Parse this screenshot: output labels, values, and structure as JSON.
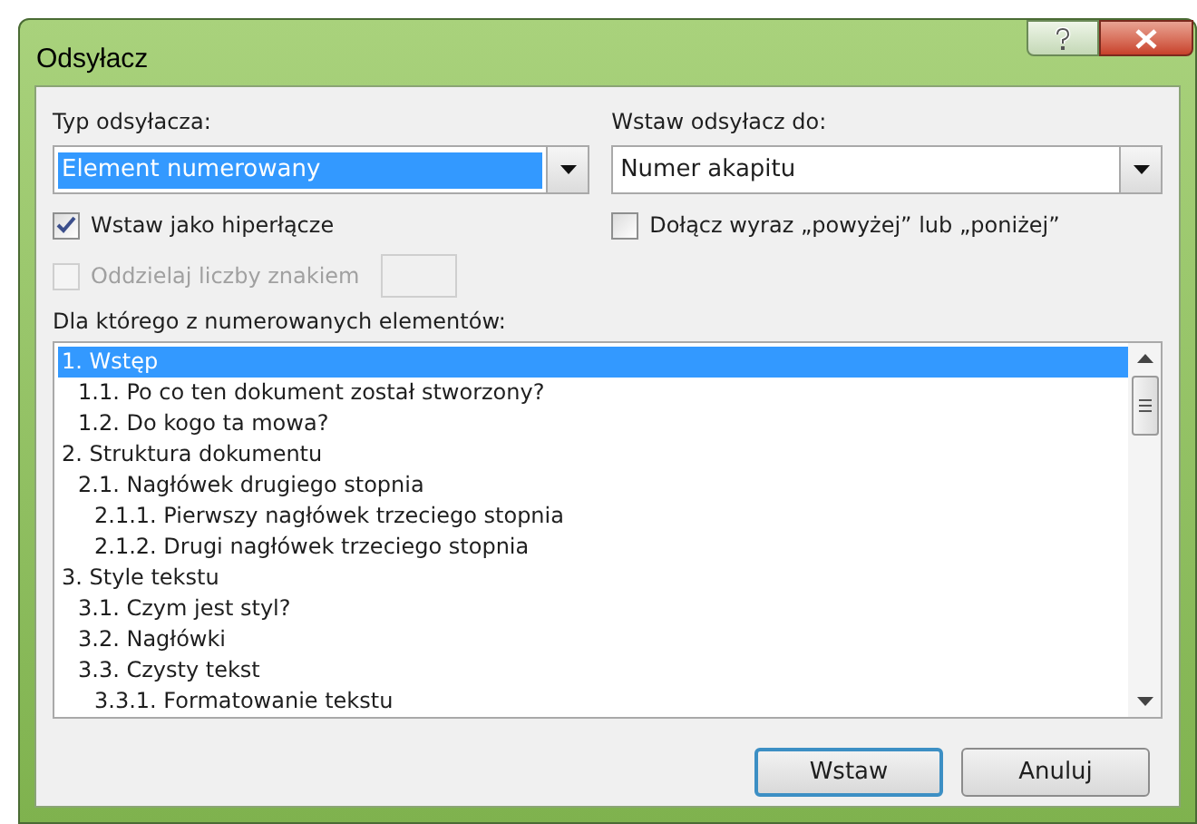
{
  "window": {
    "title": "Odsyłacz"
  },
  "reference_type": {
    "label": "Typ odsyłacza:",
    "value": "Element numerowany"
  },
  "insert_reference_to": {
    "label": "Wstaw odsyłacz do:",
    "value": "Numer akapitu"
  },
  "checkboxes": [
    {
      "label": "Wstaw jako hiperłącze",
      "checked": true,
      "disabled": false
    },
    {
      "label": "Dołącz wyraz „powyżej” lub „poniżej”",
      "checked": false,
      "disabled": false
    },
    {
      "label": "Oddzielaj liczby znakiem",
      "checked": false,
      "disabled": true
    }
  ],
  "list": {
    "label": "Dla którego z numerowanych elementów:",
    "items": [
      {
        "text": "1. Wstęp",
        "selected": true,
        "children": [
          {
            "text": "1.1. Po co ten dokument został stworzony?",
            "selected": false
          },
          {
            "text": "1.2. Do kogo ta mowa?",
            "selected": false
          }
        ]
      },
      {
        "text": "2. Struktura dokumentu",
        "selected": false,
        "children": [
          {
            "text": "2.1. Nagłówek drugiego stopnia",
            "selected": false,
            "children": [
              {
                "text": "2.1.1. Pierwszy nagłówek trzeciego stopnia",
                "selected": false
              },
              {
                "text": "2.1.2. Drugi nagłówek trzeciego stopnia",
                "selected": false
              }
            ]
          }
        ]
      },
      {
        "text": "3. Style tekstu",
        "selected": false,
        "children": [
          {
            "text": "3.1. Czym jest styl?",
            "selected": false
          },
          {
            "text": "3.2. Nagłówki",
            "selected": false
          },
          {
            "text": "3.3. Czysty tekst",
            "selected": false,
            "children": [
              {
                "text": "3.3.1. Formatowanie tekstu",
                "selected": false
              }
            ]
          }
        ]
      }
    ]
  },
  "buttons": [
    {
      "label": "Wstaw",
      "default": true
    },
    {
      "label": "Anuluj",
      "default": false
    }
  ]
}
